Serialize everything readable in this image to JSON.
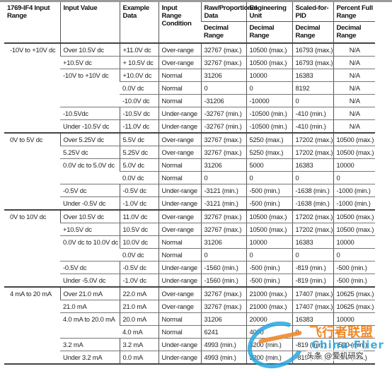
{
  "table": {
    "headers": {
      "input_range": "1769-IF4 Input Range",
      "input_value": "Input Value",
      "example_data": "Example Data",
      "condition": "Input Range Condition",
      "raw": "Raw/Proportional Data",
      "eng": "Engineering Unit",
      "pid": "Scaled-for-PID",
      "pct": "Percent Full Range",
      "sub": "Decimal Range"
    },
    "groups": [
      {
        "range": "-10V to +10V dc",
        "rows": [
          {
            "value": "Over 10.5V dc",
            "example": "+11.0V dc",
            "condition": "Over-range",
            "raw": "32767 (max.)",
            "eng": "10500 (max.)",
            "pid": "16793 (max.)",
            "pct": "N/A"
          },
          {
            "value": "+10.5V dc",
            "example": "+ 10.5V dc",
            "condition": "Over-range",
            "raw": "32767 (max.)",
            "eng": "10500 (max.)",
            "pid": "16793 (max.)",
            "pct": "N/A"
          },
          {
            "value": "-10V to +10V dc",
            "example": "+10.0V dc",
            "condition": "Normal",
            "raw": "31206",
            "eng": "10000",
            "pid": "16383",
            "pct": "N/A"
          },
          {
            "value": "",
            "example": "0.0V dc",
            "condition": "Normal",
            "raw": "0",
            "eng": "0",
            "pid": "8192",
            "pct": "N/A"
          },
          {
            "value": "",
            "example": "-10.0V dc",
            "condition": "Normal",
            "raw": "-31206",
            "eng": "-10000",
            "pid": "0",
            "pct": "N/A"
          },
          {
            "value": "-10.5Vdc",
            "example": "-10.5V dc",
            "condition": "Under-range",
            "raw": "-32767 (min.)",
            "eng": "-10500 (min.)",
            "pid": "-410 (min.)",
            "pct": "N/A"
          },
          {
            "value": "Under -10.5V dc",
            "example": "-11.0V dc",
            "condition": "Under-range",
            "raw": "-32767 (min.)",
            "eng": "-10500 (min.)",
            "pid": "-410 (min.)",
            "pct": "N/A"
          }
        ]
      },
      {
        "range": "0V to 5V dc",
        "rows": [
          {
            "value": "Over 5.25V dc",
            "example": "5.5V dc",
            "condition": "Over-range",
            "raw": "32767 (max.)",
            "eng": "5250 (max.)",
            "pid": "17202 (max.)",
            "pct": "10500 (max.)"
          },
          {
            "value": "5.25V dc",
            "example": "5.25V dc",
            "condition": "Over-range",
            "raw": "32767 (max.)",
            "eng": "5250 (max.)",
            "pid": "17202 (max.)",
            "pct": "10500 (max.)"
          },
          {
            "value": "0.0V dc to 5.0V dc",
            "example": "5.0V dc",
            "condition": "Normal",
            "raw": "31206",
            "eng": "5000",
            "pid": "16383",
            "pct": "10000"
          },
          {
            "value": "",
            "example": "0.0V dc",
            "condition": "Normal",
            "raw": "0",
            "eng": "0",
            "pid": "0",
            "pct": "0"
          },
          {
            "value": "-0.5V dc",
            "example": "-0.5V dc",
            "condition": "Under-range",
            "raw": "-3121 (min.)",
            "eng": "-500 (min.)",
            "pid": "-1638 (min.)",
            "pct": "-1000 (min.)"
          },
          {
            "value": "Under -0.5V dc",
            "example": "-1.0V dc",
            "condition": "Under-range",
            "raw": "-3121 (min.)",
            "eng": "-500 (min.)",
            "pid": "-1638 (min.)",
            "pct": "-1000 (min.)"
          }
        ]
      },
      {
        "range": "0V to 10V dc",
        "rows": [
          {
            "value": "Over 10.5V dc",
            "example": "11.0V dc",
            "condition": "Over-range",
            "raw": "32767 (max.)",
            "eng": "10500 (max.)",
            "pid": "17202 (max.)",
            "pct": "10500 (max.)"
          },
          {
            "value": "+10.5V dc",
            "example": "10.5V dc",
            "condition": "Over-range",
            "raw": "32767 (max.)",
            "eng": "10500 (max.)",
            "pid": "17202 (max.)",
            "pct": "10500 (max.)"
          },
          {
            "value": "0.0V dc to 10.0V dc",
            "example": "10.0V dc",
            "condition": "Normal",
            "raw": "31206",
            "eng": "10000",
            "pid": "16383",
            "pct": "10000"
          },
          {
            "value": "",
            "example": "0.0V dc",
            "condition": "Normal",
            "raw": "0",
            "eng": "0",
            "pid": "0",
            "pct": "0"
          },
          {
            "value": "-0.5V dc",
            "example": "-0.5V dc",
            "condition": "Under-range",
            "raw": "-1560 (min.)",
            "eng": "-500 (min.)",
            "pid": "-819 (min.)",
            "pct": "-500 (min.)"
          },
          {
            "value": "Under -5.0V dc",
            "example": "-1.0V dc",
            "condition": "Under-range",
            "raw": "-1560 (min.)",
            "eng": "-500 (min.)",
            "pid": "-819 (min.)",
            "pct": "-500 (min.)"
          }
        ]
      },
      {
        "range": "4 mA to 20 mA",
        "rows": [
          {
            "value": "Over 21.0 mA",
            "example": "22.0 mA",
            "condition": "Over-range",
            "raw": "32767 (max.)",
            "eng": "21000 (max.)",
            "pid": "17407 (max.)",
            "pct": "10625 (max.)"
          },
          {
            "value": "21.0 mA",
            "example": "21.0 mA",
            "condition": "Over-range",
            "raw": "32767 (max.)",
            "eng": "21000 (max.)",
            "pid": "17407 (max.)",
            "pct": "10625 (max.)"
          },
          {
            "value": "4.0 mA to 20.0 mA",
            "example": "20.0 mA",
            "condition": "Normal",
            "raw": "31206",
            "eng": "20000",
            "pid": "16383",
            "pct": "10000"
          },
          {
            "value": "",
            "example": "4.0 mA",
            "condition": "Normal",
            "raw": "6241",
            "eng": "4000",
            "pid": "0",
            "pct": "0"
          },
          {
            "value": "3.2 mA",
            "example": "3.2 mA",
            "condition": "Under-range",
            "raw": "4993 (min.)",
            "eng": "3200 (min.)",
            "pid": "-819 (min.)",
            "pct": "-500 (min.)"
          },
          {
            "value": "Under 3.2 mA",
            "example": "0.0 mA",
            "condition": "Under-range",
            "raw": "4993 (min.)",
            "eng": "3200 (min.)",
            "pid": "-819 (min.)",
            "pct": "-500 (min.)"
          }
        ]
      }
    ]
  },
  "watermark": {
    "brand_cn": "飞行者联盟",
    "brand_en": "China-Flier",
    "credit": "头条 @爱机研究"
  }
}
